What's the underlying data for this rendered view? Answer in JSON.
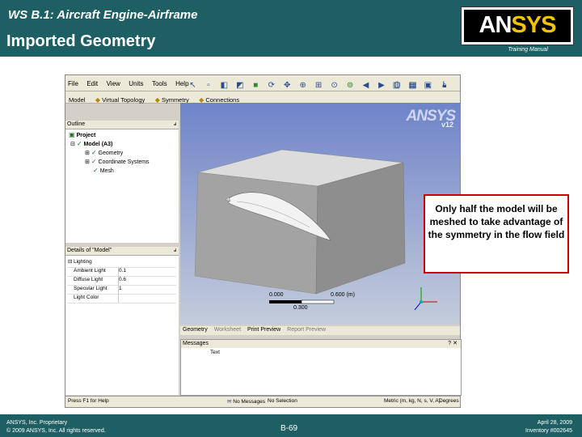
{
  "slide": {
    "title_line1": "WS B.1: Aircraft Engine-Airframe",
    "title_line2": "Imported Geometry",
    "training_manual": "Training Manual",
    "logo_text_left": "AN",
    "logo_text_right": "SYS",
    "callout": "Only half the model will be meshed to take advantage of the symmetry in the flow field",
    "footer": {
      "left_line1": "ANSYS, Inc. Proprietary",
      "left_line2": "© 2009 ANSYS, Inc.  All rights reserved.",
      "page": "B-69",
      "right_line1": "April 28, 2009",
      "right_line2": "Inventory #002645"
    },
    "colors": {
      "header_bg": "#1e5f64",
      "callout_border": "#cc0000",
      "logo_accent": "#f2c300"
    }
  },
  "app": {
    "menu": [
      "File",
      "Edit",
      "View",
      "Units",
      "Tools",
      "Help"
    ],
    "toolbar2": [
      "Model",
      "Virtual Topology",
      "Symmetry",
      "Connections"
    ],
    "outline": {
      "title": "Outline",
      "items": [
        "Project",
        "Model (A3)",
        "Geometry",
        "Coordinate Systems",
        "Mesh"
      ]
    },
    "details": {
      "title": "Details of \"Model\"",
      "section": "Lighting",
      "props": [
        {
          "name": "Ambient Light",
          "value": "0.1"
        },
        {
          "name": "Diffuse Light",
          "value": "0.6"
        },
        {
          "name": "Specular Light",
          "value": "1"
        },
        {
          "name": "Light Color",
          "value": ""
        }
      ]
    },
    "viewport": {
      "logo": "ANSYS",
      "version": "v12",
      "scale_left": "0.000",
      "scale_mid": "0.300",
      "scale_right": "0.600 (m)"
    },
    "view_tabs": [
      "Geometry",
      "Worksheet",
      "Print Preview",
      "Report Preview"
    ],
    "messages": {
      "title": "Messages",
      "column": "Text"
    },
    "status": {
      "help": "Press F1 for Help",
      "messages": "No Messages",
      "selection": "No Selection",
      "units": "Metric (m, kg, N, s, V, A)",
      "degrees": "Degrees"
    }
  }
}
